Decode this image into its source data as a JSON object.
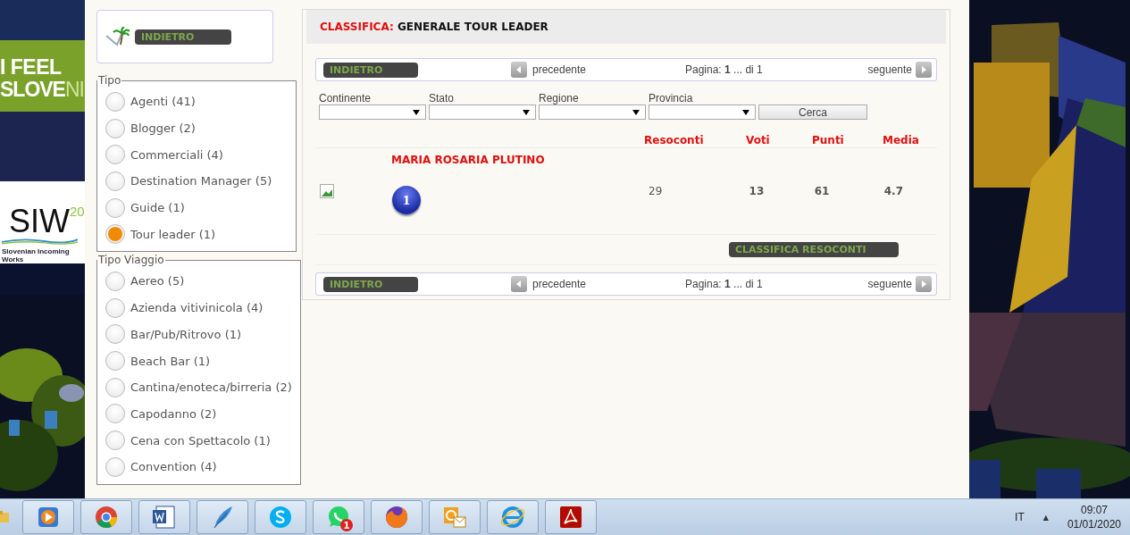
{
  "banner": {
    "line_1": "I FEEL",
    "line_2_bold": "SLOVE",
    "line_2_light": "NI",
    "logo": "SIW",
    "logo_year": "20",
    "caption": "Slovenian Incoming Works"
  },
  "sidebar": {
    "back_button": "INDIETRO",
    "groups": [
      {
        "title": "Tipo",
        "items": [
          {
            "label": "Agenti (41)",
            "selected": false
          },
          {
            "label": "Blogger (2)",
            "selected": false
          },
          {
            "label": "Commerciali (4)",
            "selected": false
          },
          {
            "label": "Destination Manager (5)",
            "selected": false
          },
          {
            "label": "Guide (1)",
            "selected": false
          },
          {
            "label": "Tour leader (1)",
            "selected": true
          }
        ]
      },
      {
        "title": "Tipo Viaggio",
        "items": [
          {
            "label": "Aereo (5)",
            "selected": false
          },
          {
            "label": "Azienda vitivinicola (4)",
            "selected": false
          },
          {
            "label": "Bar/Pub/Ritrovo (1)",
            "selected": false
          },
          {
            "label": "Beach Bar (1)",
            "selected": false
          },
          {
            "label": "Cantina/enoteca/birreria (2)",
            "selected": false
          },
          {
            "label": "Capodanno (2)",
            "selected": false
          },
          {
            "label": "Cena con Spettacolo (1)",
            "selected": false
          },
          {
            "label": "Convention (4)",
            "selected": false
          }
        ]
      }
    ]
  },
  "main": {
    "title_label": "CLASSIFICA:",
    "title": "GENERALE TOUR LEADER",
    "pager_top": {
      "back_button": "INDIETRO",
      "prev": "precedente",
      "page_label": "Pagina:",
      "page": "1",
      "page_rest": "... di 1",
      "next": "seguente"
    },
    "filters": [
      {
        "label": "Continente"
      },
      {
        "label": "Stato"
      },
      {
        "label": "Regione"
      },
      {
        "label": "Provincia"
      }
    ],
    "search_button": "Cerca",
    "columns": [
      "Resoconti",
      "Voti",
      "Punti",
      "Media"
    ],
    "rows": [
      {
        "name": "MARIA ROSARIA PLUTINO",
        "rank": "1",
        "values": [
          "29",
          "13",
          "61",
          "4.7"
        ]
      }
    ],
    "report_button": "CLASSIFICA RESOCONTI",
    "pager_bottom": {
      "back_button": "INDIETRO",
      "prev": "precedente",
      "page_label": "Pagina:",
      "page": "1",
      "page_rest": "... di 1",
      "next": "seguente"
    }
  },
  "taskbar": {
    "apps": [
      {
        "kind": "media"
      },
      {
        "kind": "chrome"
      },
      {
        "kind": "word"
      },
      {
        "kind": "quill"
      },
      {
        "kind": "skype"
      },
      {
        "kind": "whatsapp",
        "badge": "1"
      },
      {
        "kind": "firefox"
      },
      {
        "kind": "outlook"
      },
      {
        "kind": "ie"
      },
      {
        "kind": "pdf"
      }
    ],
    "language": "IT",
    "tray_arrow": "▲",
    "time": "09:07",
    "date": "01/01/2020"
  }
}
